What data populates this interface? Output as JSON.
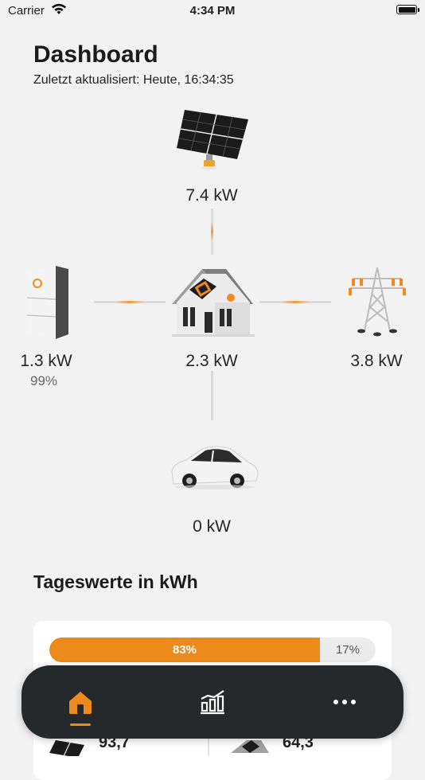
{
  "status_bar": {
    "carrier": "Carrier",
    "time": "4:34 PM"
  },
  "header": {
    "title": "Dashboard",
    "last_updated": "Zuletzt aktualisiert: Heute, 16:34:35"
  },
  "energy_flow": {
    "solar": {
      "label": "7.4 kW"
    },
    "battery": {
      "label": "1.3 kW",
      "charge": "99%"
    },
    "house": {
      "label": "2.3 kW"
    },
    "grid": {
      "label": "3.8 kW"
    },
    "car": {
      "label": "0 kW"
    }
  },
  "daily_values": {
    "title": "Tageswerte in kWh",
    "self_consumption_pct": 83,
    "self_consumption_label": "83%",
    "rest_label": "17%",
    "cards": [
      {
        "value": "93,7",
        "icon": "solar-panel-icon"
      },
      {
        "value": "64,3",
        "icon": "house-solar-icon"
      }
    ]
  },
  "tab_bar": {
    "items": [
      {
        "name": "home",
        "icon": "home-icon",
        "active": true
      },
      {
        "name": "statistics",
        "icon": "chart-icon",
        "active": false
      },
      {
        "name": "more",
        "icon": "more-icon",
        "active": false
      }
    ]
  },
  "colors": {
    "accent": "#ec8a1b",
    "tabbar": "#26292b",
    "background": "#f2f2f2"
  }
}
